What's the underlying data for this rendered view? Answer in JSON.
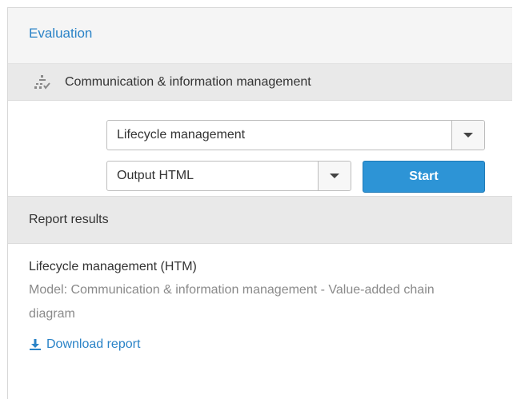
{
  "evaluation": {
    "title": "Evaluation"
  },
  "model_bar": {
    "icon": "value-chain-icon",
    "name": "Communication & information management"
  },
  "controls": {
    "report_select": {
      "value": "Lifecycle management",
      "icon": "chevron-down-icon"
    },
    "format_select": {
      "value": "Output HTML",
      "icon": "chevron-down-icon"
    },
    "start_label": "Start"
  },
  "results": {
    "title": "Report results",
    "item": {
      "name": "Lifecycle management  (HTM)",
      "meta": "Model: Communication & information management - Value-added chain diagram",
      "download_label": "Download report",
      "download_icon": "download-icon"
    }
  },
  "colors": {
    "accent": "#2a83c7",
    "button": "#2d94d6",
    "bar": "#e9e9e9"
  }
}
